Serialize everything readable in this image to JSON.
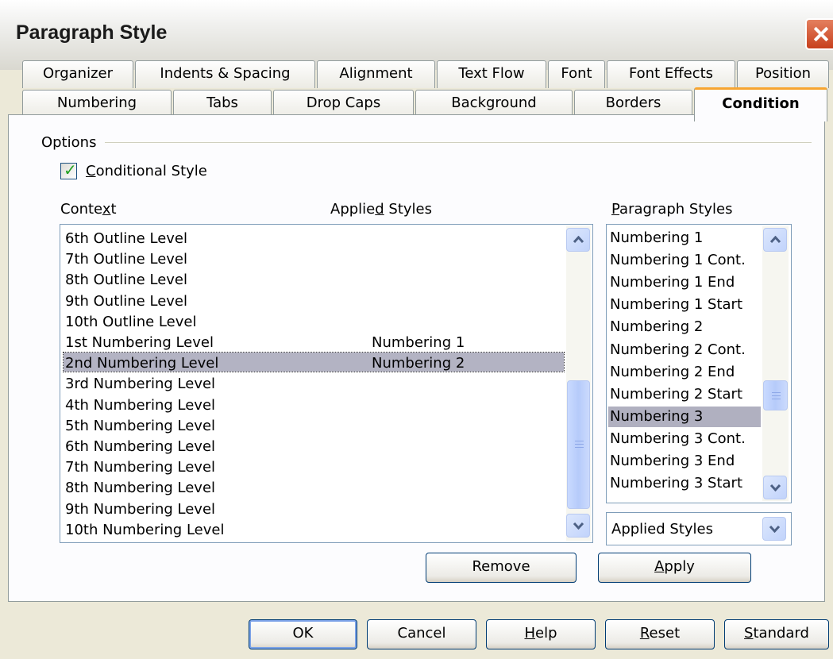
{
  "window": {
    "title": "Paragraph Style"
  },
  "tabs": {
    "row1": [
      "Organizer",
      "Indents & Spacing",
      "Alignment",
      "Text Flow",
      "Font",
      "Font Effects",
      "Position"
    ],
    "row2": [
      "Numbering",
      "Tabs",
      "Drop Caps",
      "Background",
      "Borders",
      "Condition"
    ],
    "active": "Condition"
  },
  "options": {
    "group_label": "Options",
    "conditional_style_label": "Conditional Style",
    "conditional_style_checked": true
  },
  "context": {
    "header_context": "Context",
    "header_applied": "Applied Styles",
    "rows": [
      {
        "context": "6th Outline Level",
        "applied": ""
      },
      {
        "context": "7th Outline Level",
        "applied": ""
      },
      {
        "context": "8th Outline Level",
        "applied": ""
      },
      {
        "context": "9th Outline Level",
        "applied": ""
      },
      {
        "context": "10th Outline Level",
        "applied": ""
      },
      {
        "context": "1st Numbering Level",
        "applied": "Numbering 1"
      },
      {
        "context": "2nd Numbering Level",
        "applied": "Numbering 2"
      },
      {
        "context": "3rd Numbering Level",
        "applied": ""
      },
      {
        "context": "4th Numbering Level",
        "applied": ""
      },
      {
        "context": "5th Numbering Level",
        "applied": ""
      },
      {
        "context": "6th Numbering Level",
        "applied": ""
      },
      {
        "context": "7th Numbering Level",
        "applied": ""
      },
      {
        "context": "8th Numbering Level",
        "applied": ""
      },
      {
        "context": "9th Numbering Level",
        "applied": ""
      },
      {
        "context": "10th Numbering Level",
        "applied": ""
      }
    ],
    "selected_row": "2nd Numbering Level"
  },
  "paragraph_styles": {
    "header": "Paragraph Styles",
    "items": [
      "Numbering 1",
      "Numbering 1 Cont.",
      "Numbering 1 End",
      "Numbering 1 Start",
      "Numbering 2",
      "Numbering 2 Cont.",
      "Numbering 2 End",
      "Numbering 2 Start",
      "Numbering 3",
      "Numbering 3 Cont.",
      "Numbering 3 End",
      "Numbering 3 Start"
    ],
    "selected": "Numbering 3",
    "filter_value": "Applied Styles"
  },
  "actions": {
    "remove": "Remove",
    "apply": "Apply"
  },
  "footer": {
    "ok": "OK",
    "cancel": "Cancel",
    "help": "Help",
    "reset": "Reset",
    "standard": "Standard"
  },
  "colors": {
    "selection": "#b3b3c3",
    "active_tab_accent": "#f7a531",
    "close_button": "#c7401d",
    "button_border": "#003c74"
  }
}
